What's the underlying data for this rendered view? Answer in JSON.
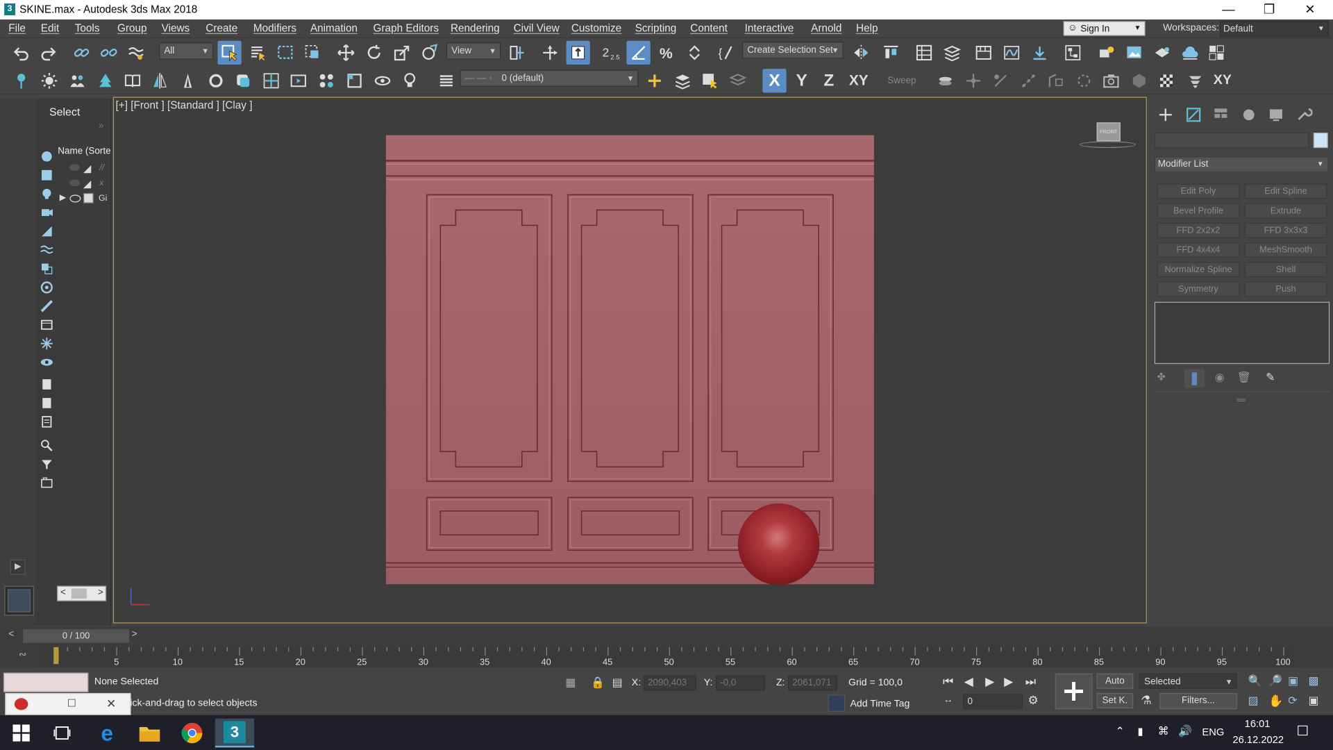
{
  "window": {
    "title": "SKINE.max - Autodesk 3ds Max 2018",
    "app_icon_text": "3",
    "controls": [
      "minimize-icon",
      "maximize-icon",
      "close-icon"
    ]
  },
  "menubar": {
    "items": [
      "File",
      "Edit",
      "Tools",
      "Group",
      "Views",
      "Create",
      "Modifiers",
      "Animation",
      "Graph Editors",
      "Rendering",
      "Civil View",
      "Customize",
      "Scripting",
      "Content",
      "Interactive",
      "Arnold",
      "Help"
    ],
    "sign_in": "Sign In",
    "workspaces_label": "Workspaces:",
    "workspace_value": "Default"
  },
  "toolbar": {
    "selection_filter": "All",
    "reference_coord": "View",
    "snap_label": "2.5",
    "selection_set": "Create Selection Set",
    "layer": "0 (default)",
    "axis_x": "X",
    "axis_y": "Y",
    "axis_z": "Z",
    "axis_xy": "XY",
    "sweep_label": "Sweep",
    "axis_xy2": "XY"
  },
  "scene_explorer": {
    "title": "Select",
    "column_header": "Name (Sorte",
    "rows": [
      {
        "label": "//",
        "has_arrow": false
      },
      {
        "label": "x",
        "has_arrow": false
      },
      {
        "label": "Gi",
        "has_arrow": true
      }
    ]
  },
  "viewport": {
    "label": "[+] [Front ] [Standard ] [Clay ]",
    "viewcube_label": "FRONT",
    "wall_color": "#a0626a",
    "sphere_color": "#a02a2e"
  },
  "command_panel": {
    "modifier_list": "Modifier List",
    "buttons": [
      "Edit Poly",
      "Edit Spline",
      "Bevel Profile",
      "Extrude",
      "FFD 2x2x2",
      "FFD 3x3x3",
      "FFD 4x4x4",
      "MeshSmooth",
      "Normalize Spline",
      "Shell",
      "Symmetry",
      "Push"
    ]
  },
  "timeline": {
    "frame_display": "0 / 100",
    "ticks": [
      "5",
      "10",
      "15",
      "20",
      "25",
      "30",
      "35",
      "40",
      "45",
      "50",
      "55",
      "60",
      "65",
      "70",
      "75",
      "80",
      "85",
      "90",
      "95",
      "100"
    ]
  },
  "statusbar": {
    "selection_status": "None Selected",
    "prompt": "ick-and-drag to select objects",
    "x_label": "X:",
    "x_value": "2090,403",
    "y_label": "Y:",
    "y_value": "-0,0",
    "z_label": "Z:",
    "z_value": "2061,071",
    "grid": "Grid = 100,0",
    "add_time_tag": "Add Time Tag",
    "auto": "Auto",
    "set_key": "Set K.",
    "selected": "Selected",
    "filters": "Filters...",
    "frame_value": "0"
  },
  "taskbar": {
    "language": "ENG",
    "time": "16:01",
    "date": "26.12.2022",
    "max_icon_text": "3"
  }
}
